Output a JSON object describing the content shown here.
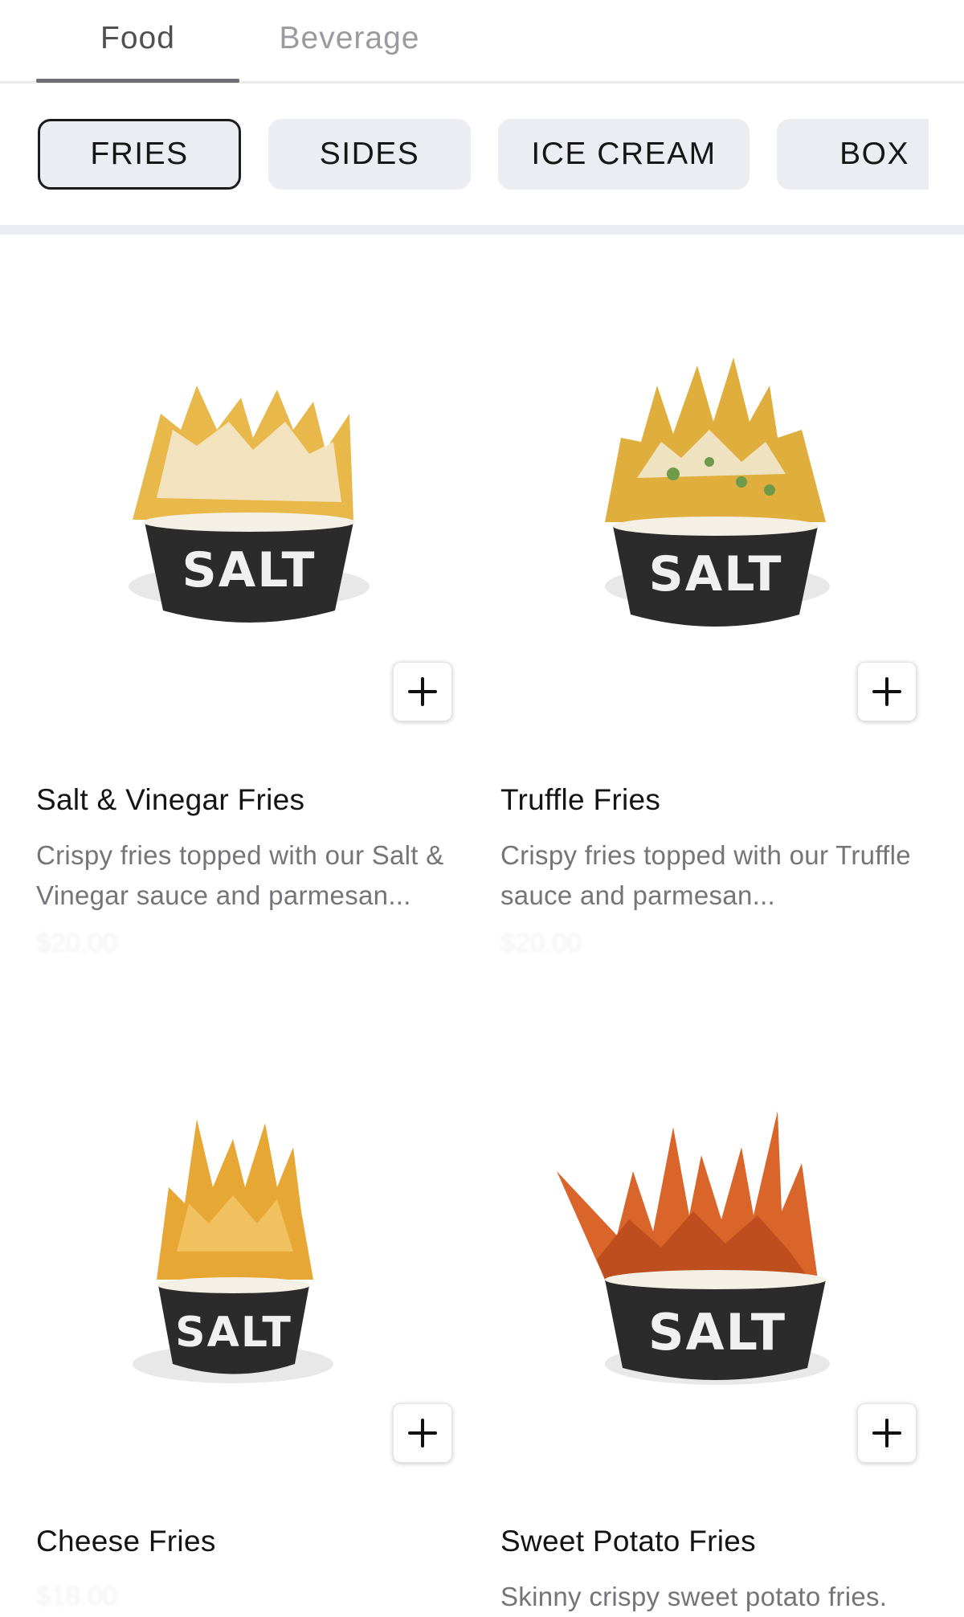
{
  "top_tabs": [
    {
      "label": "Food",
      "active": true
    },
    {
      "label": "Beverage",
      "active": false
    }
  ],
  "categories": [
    {
      "label": "FRIES",
      "active": true
    },
    {
      "label": "SIDES",
      "active": false
    },
    {
      "label": "ICE CREAM",
      "active": false
    },
    {
      "label": "BOX",
      "active": false
    }
  ],
  "products": [
    {
      "name": "Salt & Vinegar Fries",
      "description": "Crispy fries topped with our Salt & Vinegar sauce and parmesan...",
      "price": "$20.00",
      "cup_label": "SALT",
      "fries_color": "#e8b84a",
      "topping_color": "#f3ead2"
    },
    {
      "name": "Truffle Fries",
      "description": "Crispy fries topped with our Truffle sauce and parmesan...",
      "price": "$20.00",
      "cup_label": "SALT",
      "fries_color": "#dfae3c",
      "topping_color": "#6f9a4a"
    },
    {
      "name": "Cheese Fries",
      "description": "",
      "price": "$18.00",
      "cup_label": "SALT",
      "fries_color": "#e6a734",
      "topping_color": "#f2c464"
    },
    {
      "name": "Sweet Potato Fries",
      "description": "Skinny crispy sweet potato fries.",
      "price": "$18.00",
      "cup_label": "SALT",
      "fries_color": "#d9652a",
      "topping_color": "#b94a1c"
    }
  ],
  "icons": {
    "add": "plus-icon"
  },
  "colors": {
    "pill_bg": "#ecedf2",
    "active_border": "#1c1c1c",
    "cup": "#2b2b2b",
    "muted_text": "#74747a"
  }
}
